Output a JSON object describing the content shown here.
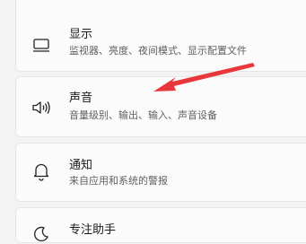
{
  "settings": {
    "items": [
      {
        "icon": "monitor-icon",
        "title": "显示",
        "subtitle": "监视器、亮度、夜间模式、显示配置文件"
      },
      {
        "icon": "speaker-icon",
        "title": "声音",
        "subtitle": "音量级别、输出、输入、声音设备"
      },
      {
        "icon": "bell-icon",
        "title": "通知",
        "subtitle": "来自应用和系统的警报"
      },
      {
        "icon": "focus-assist-icon",
        "title": "专注助手"
      }
    ]
  },
  "annotation": {
    "arrow_color": "#e8373b"
  }
}
